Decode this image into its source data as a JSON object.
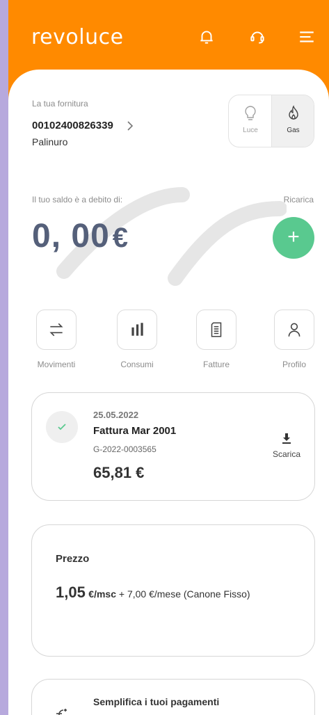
{
  "header": {
    "logo": "revoluce",
    "icons": [
      "bell-icon",
      "headset-icon",
      "menu-icon"
    ],
    "background": "#ff8a00"
  },
  "fornitura": {
    "label": "La tua fornitura",
    "pod": "00102400826339",
    "city": "Palinuro"
  },
  "supply_toggle": {
    "options": [
      {
        "label": "Luce",
        "icon": "lightbulb-icon",
        "selected": false
      },
      {
        "label": "Gas",
        "icon": "flame-icon",
        "selected": true
      }
    ]
  },
  "saldo": {
    "label": "Il tuo saldo è a debito di:",
    "amount": "0, 00",
    "currency": "€",
    "ricarica_label": "Ricarica",
    "add_symbol": "+",
    "accent": "#59c98f"
  },
  "quick_actions": [
    {
      "label": "Movimenti",
      "icon": "transfer-arrows-icon"
    },
    {
      "label": "Consumi",
      "icon": "bar-chart-icon"
    },
    {
      "label": "Fatture",
      "icon": "document-icon"
    },
    {
      "label": "Profilo",
      "icon": "user-icon"
    }
  ],
  "invoice": {
    "date": "25.05.2022",
    "title": "Fattura Mar 2001",
    "code": "G-2022-0003565",
    "amount": "65,81 €",
    "download_label": "Scarica",
    "status_icon": "check-icon"
  },
  "price": {
    "title": "Prezzo",
    "value": "1,05",
    "unit": "€/msc",
    "rest": " + 7,00 €/mese (Canone Fisso)"
  },
  "payments": {
    "title": "Semplifica i tuoi pagamenti",
    "icon": "euro-plus-icon"
  }
}
